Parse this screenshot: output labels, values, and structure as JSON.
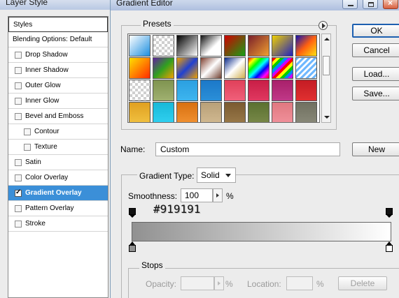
{
  "layer_style": {
    "title": "Layer Style",
    "header": "Styles",
    "items": [
      {
        "label": "Blending Options: Default",
        "checkbox": false,
        "checked": false,
        "selected": false,
        "indent": false
      },
      {
        "label": "Drop Shadow",
        "checkbox": true,
        "checked": false,
        "selected": false,
        "indent": false
      },
      {
        "label": "Inner Shadow",
        "checkbox": true,
        "checked": false,
        "selected": false,
        "indent": false
      },
      {
        "label": "Outer Glow",
        "checkbox": true,
        "checked": false,
        "selected": false,
        "indent": false
      },
      {
        "label": "Inner Glow",
        "checkbox": true,
        "checked": false,
        "selected": false,
        "indent": false
      },
      {
        "label": "Bevel and Emboss",
        "checkbox": true,
        "checked": false,
        "selected": false,
        "indent": false
      },
      {
        "label": "Contour",
        "checkbox": true,
        "checked": false,
        "selected": false,
        "indent": true
      },
      {
        "label": "Texture",
        "checkbox": true,
        "checked": false,
        "selected": false,
        "indent": true
      },
      {
        "label": "Satin",
        "checkbox": true,
        "checked": false,
        "selected": false,
        "indent": false
      },
      {
        "label": "Color Overlay",
        "checkbox": true,
        "checked": false,
        "selected": false,
        "indent": false
      },
      {
        "label": "Gradient Overlay",
        "checkbox": true,
        "checked": true,
        "selected": true,
        "indent": false
      },
      {
        "label": "Pattern Overlay",
        "checkbox": true,
        "checked": false,
        "selected": false,
        "indent": false
      },
      {
        "label": "Stroke",
        "checkbox": true,
        "checked": false,
        "selected": false,
        "indent": false
      }
    ]
  },
  "gradient_editor": {
    "title": "Gradient Editor",
    "presets_label": "Presets",
    "buttons": {
      "ok": "OK",
      "cancel": "Cancel",
      "load": "Load...",
      "save": "Save...",
      "new": "New"
    },
    "name_label": "Name:",
    "name_value": "Custom",
    "gradient_type_label": "Gradient Type:",
    "gradient_type_value": "Solid",
    "smoothness_label": "Smoothness:",
    "smoothness_value": "100",
    "smoothness_unit": "%",
    "overlay_text": "#919191",
    "gradient_start_color": "#919191",
    "gradient_end_color": "#ffffff",
    "stops": {
      "label": "Stops",
      "opacity_label": "Opacity:",
      "opacity_unit": "%",
      "location_label": "Location:",
      "location_unit": "%",
      "delete_label": "Delete"
    },
    "preset_swatches": [
      "linear-gradient(135deg,#ffffff,#1d8fe0)",
      "repeating-conic-gradient(#cfcfcf 0 25%,#ffffff 0 50%) 0 0/8px 8px",
      "linear-gradient(135deg,#000,#fff)",
      "linear-gradient(135deg,#111,#fff 60%,#fff)",
      "linear-gradient(135deg,#d00000,#16a016)",
      "linear-gradient(135deg,#7a1f2b,#f09f30)",
      "linear-gradient(135deg,#f0d000,#2020c0)",
      "linear-gradient(135deg,#1010b0,#ff6010,#ffe010)",
      "linear-gradient(135deg,#ffe000,#ff2a00)",
      "linear-gradient(135deg,#6020a0,#30a020,#f0a000)",
      "linear-gradient(135deg,#f0a000,#2040d0 50%,#f0a000)",
      "linear-gradient(135deg,#804030,#fff 50%,#704030)",
      "linear-gradient(135deg,#0a2a8a,#fff 50%,#d0b050)",
      "linear-gradient(135deg,#f00,#ff0,#0f0,#0ff,#00f,#f0f,#f00)",
      "repeating-linear-gradient(135deg,#f00 0 4px,#ff0 4px 8px,#0c0 8px 12px,#08f 12px 16px,#c0f 16px 20px)",
      "repeating-linear-gradient(135deg,#6fb8ff 0 3px,#ffffff 3px 6px)",
      "repeating-conic-gradient(#cfcfcf 0 25%,#ffffff 0 50%) 0 0/8px 8px",
      "linear-gradient(#7f9350,#a0b070)",
      "linear-gradient(#2b9fe0,#3db5ef)",
      "linear-gradient(#1c78c8,#2a8fd8)",
      "linear-gradient(#e0405a,#f0607a)",
      "linear-gradient(#c81e46,#e03860)",
      "linear-gradient(#a8206a,#c03888)",
      "linear-gradient(#c41c24,#e03030)",
      "linear-gradient(#e0a020,#f0c040)",
      "linear-gradient(#18b8d8,#30d0f0)",
      "linear-gradient(#d87010,#f09030)",
      "linear-gradient(#b8a078,#d0b890)",
      "linear-gradient(#7a5a30,#987848)",
      "linear-gradient(#5a7030,#788848)",
      "linear-gradient(#e07880,#f0909a)",
      "linear-gradient(#707060,#888878)",
      "linear-gradient(#38a8b8,#50c0d0)"
    ]
  }
}
